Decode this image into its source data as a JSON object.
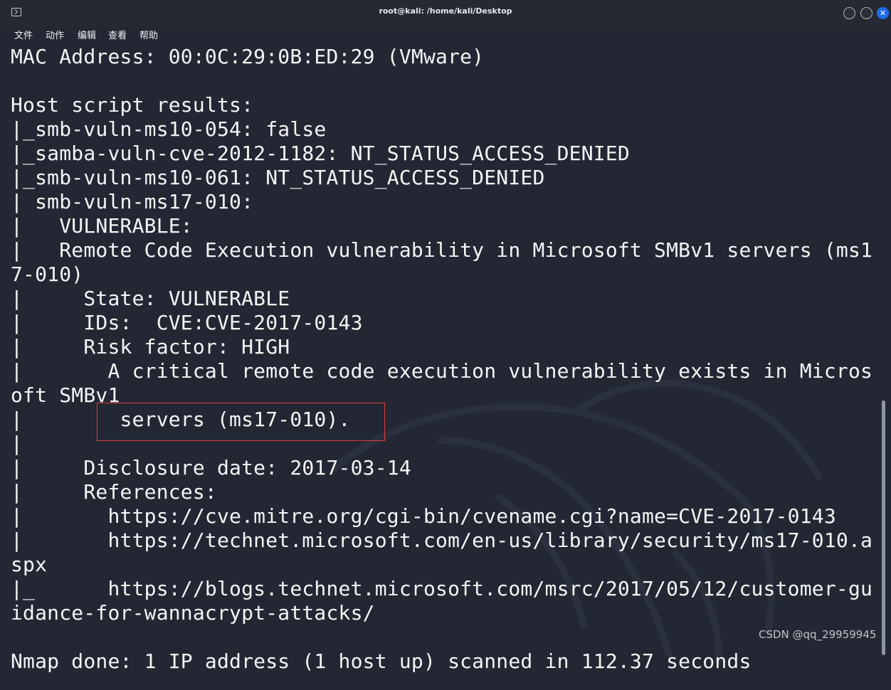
{
  "window": {
    "title": "root@kali: /home/kali/Desktop",
    "close_glyph": "✕"
  },
  "menu": {
    "items": [
      "文件",
      "动作",
      "编辑",
      "查看",
      "帮助"
    ]
  },
  "terminal": {
    "lines": [
      "MAC Address: 00:0C:29:0B:ED:29 (VMware)",
      "",
      "Host script results:",
      "|_smb-vuln-ms10-054: false",
      "|_samba-vuln-cve-2012-1182: NT_STATUS_ACCESS_DENIED",
      "|_smb-vuln-ms10-061: NT_STATUS_ACCESS_DENIED",
      "| smb-vuln-ms17-010:",
      "|   VULNERABLE:",
      "|   Remote Code Execution vulnerability in Microsoft SMBv1 servers (ms1",
      "7-010)",
      "|     State: VULNERABLE",
      "|     IDs:  CVE:CVE-2017-0143",
      "|     Risk factor: HIGH",
      "|       A critical remote code execution vulnerability exists in Micros",
      "oft SMBv1",
      "|        servers (ms17-010).",
      "|",
      "|     Disclosure date: 2017-03-14",
      "|     References:",
      "|       https://cve.mitre.org/cgi-bin/cvename.cgi?name=CVE-2017-0143",
      "|       https://technet.microsoft.com/en-us/library/security/ms17-010.a",
      "spx",
      "|_      https://blogs.technet.microsoft.com/msrc/2017/05/12/customer-gu",
      "idance-for-wannacrypt-attacks/",
      "",
      "Nmap done: 1 IP address (1 host up) scanned in 112.37 seconds"
    ]
  },
  "watermark": "CSDN @qq_29959945",
  "colors": {
    "background": "#222733",
    "text": "#f4f5f7",
    "highlight": "#e03c3c",
    "close_button": "#1e6be8"
  }
}
